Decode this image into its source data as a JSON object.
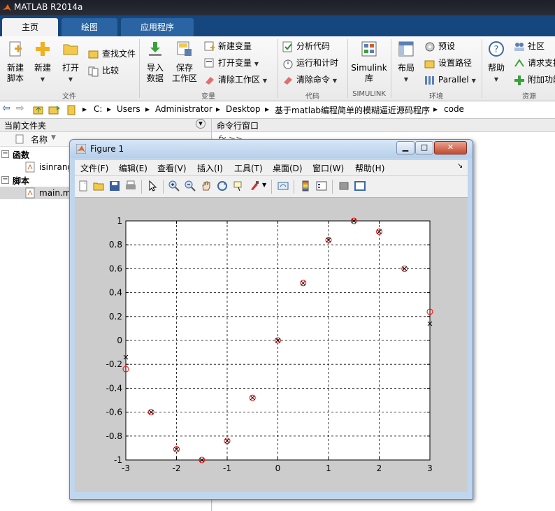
{
  "app": {
    "title": "MATLAB R2014a"
  },
  "tabs": [
    {
      "label": "主页"
    },
    {
      "label": "绘图"
    },
    {
      "label": "应用程序"
    }
  ],
  "ribbon": {
    "new_script_line1": "新建",
    "new_script_line2": "脚本",
    "new": "新建",
    "open": "打开",
    "find_files": "查找文件",
    "compare": "比较",
    "group_file": "文件",
    "import_line1": "导入",
    "import_line2": "数据",
    "save_ws_line1": "保存",
    "save_ws_line2": "工作区",
    "new_variable": "新建变量",
    "open_variable": "打开变量",
    "clear_workspace": "清除工作区",
    "group_variable": "变量",
    "analyze_code": "分析代码",
    "run_and_time": "运行和计时",
    "clear_commands": "清除命令",
    "group_code": "代码",
    "simulink_line1": "Simulink",
    "simulink_line2": "库",
    "group_simulink": "SIMULINK",
    "layout": "布局",
    "preferences": "预设",
    "set_path": "设置路径",
    "parallel": "Parallel",
    "group_environment": "环境",
    "help": "帮助",
    "community": "社区",
    "request_support": "请求支持",
    "add_ons": "附加功能",
    "group_resources": "资源"
  },
  "address": {
    "crumbs": [
      "C:",
      "Users",
      "Administrator",
      "Desktop",
      "基于matlab编程简单的模糊逼近源码程序",
      "code"
    ]
  },
  "left_panel": {
    "title": "当前文件夹",
    "column_name": "名称",
    "group_functions": "函数",
    "file_function": "isinrange.m",
    "group_scripts": "脚本",
    "file_script": "main.m"
  },
  "right_panel": {
    "title": "命令行窗口",
    "prompt": "fx >>"
  },
  "figure": {
    "title": "Figure 1",
    "menus": [
      "文件(F)",
      "编辑(E)",
      "查看(V)",
      "插入(I)",
      "工具(T)",
      "桌面(D)",
      "窗口(W)",
      "帮助(H)"
    ]
  },
  "chart_data": {
    "type": "scatter",
    "xlim": [
      -3,
      3
    ],
    "ylim": [
      -1,
      1
    ],
    "grid": true,
    "x_ticks": [
      "-3",
      "-2",
      "-1",
      "0",
      "1",
      "2",
      "3"
    ],
    "y_ticks": [
      "1",
      "0.8",
      "0.6",
      "0.4",
      "0.2",
      "0",
      "-0.2",
      "-0.4",
      "-0.6",
      "-0.8",
      "-1"
    ],
    "series": [
      {
        "marker": "o",
        "color": "#ff0000",
        "x": [
          -3,
          -2.5,
          -2,
          -1.5,
          -1,
          -0.5,
          0,
          0.5,
          1,
          1.5,
          2,
          2.5,
          3
        ],
        "y": [
          -0.24,
          -0.6,
          -0.91,
          -1.0,
          -0.84,
          -0.48,
          0.0,
          0.48,
          0.84,
          1.0,
          0.91,
          0.6,
          0.24
        ]
      },
      {
        "marker": "x",
        "color": "#000000",
        "x": [
          -3,
          -2.5,
          -2,
          -1.5,
          -1,
          -0.5,
          0,
          0.5,
          1,
          1.5,
          2,
          2.5,
          3
        ],
        "y": [
          -0.14,
          -0.6,
          -0.91,
          -1.0,
          -0.84,
          -0.48,
          0.0,
          0.48,
          0.84,
          1.0,
          0.91,
          0.6,
          0.14
        ]
      }
    ]
  }
}
